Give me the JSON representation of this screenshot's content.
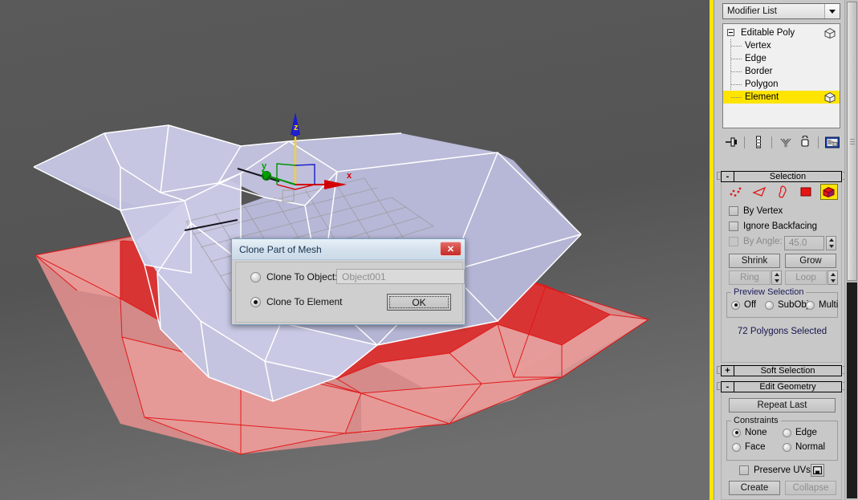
{
  "app": {
    "viewport_bg": "#545454",
    "active_viewport_border": "#ffe400",
    "panel_bg": "#c8c8c8"
  },
  "viewport": {
    "gizmo": {
      "x_label": "x",
      "y_label": "y",
      "z_label": "z",
      "x_color": "#e00000",
      "y_color": "#00a000",
      "z_color": "#ffd400"
    },
    "meshes": [
      {
        "name": "unselected-mesh",
        "fill": "#b6b6d6",
        "wire": "#ffffff"
      },
      {
        "name": "selected-mesh",
        "fill": "#d83030",
        "wire": "#e01010"
      }
    ]
  },
  "command_panel": {
    "modifier_list": {
      "label": "Modifier List",
      "icon": "chevron-down-icon"
    },
    "modifier_stack": [
      {
        "label": "Editable Poly",
        "level": 0,
        "selected": false,
        "icon": "cube-icon"
      },
      {
        "label": "Vertex",
        "level": 1,
        "selected": false
      },
      {
        "label": "Edge",
        "level": 1,
        "selected": false
      },
      {
        "label": "Border",
        "level": 1,
        "selected": false
      },
      {
        "label": "Polygon",
        "level": 1,
        "selected": false
      },
      {
        "label": "Element",
        "level": 1,
        "selected": true,
        "icon": "cube-icon"
      }
    ],
    "stack_tools": [
      {
        "name": "pin-stack-icon"
      },
      {
        "name": "show-end-result-icon"
      },
      {
        "name": "make-unique-icon"
      },
      {
        "name": "remove-modifier-icon"
      },
      {
        "name": "configure-modifier-sets-icon"
      }
    ],
    "selection_rollout": {
      "title": "Selection",
      "expander": "-",
      "subobject_icons": [
        {
          "name": "vertex-icon",
          "active": false
        },
        {
          "name": "edge-icon",
          "active": false
        },
        {
          "name": "border-icon",
          "active": false
        },
        {
          "name": "polygon-icon",
          "active": false
        },
        {
          "name": "element-icon",
          "active": true
        }
      ],
      "by_vertex": {
        "label": "By Vertex",
        "checked": false
      },
      "ignore_backfacing": {
        "label": "Ignore Backfacing",
        "checked": false
      },
      "by_angle": {
        "label": "By Angle:",
        "checked": false,
        "value": "45.0",
        "disabled": true
      },
      "shrink_label": "Shrink",
      "grow_label": "Grow",
      "ring_label": "Ring",
      "loop_label": "Loop",
      "preview_selection": {
        "title": "Preview Selection",
        "options": [
          {
            "label": "Off",
            "selected": true
          },
          {
            "label": "SubObj",
            "selected": false
          },
          {
            "label": "Multi",
            "selected": false
          }
        ]
      },
      "status": "72 Polygons Selected"
    },
    "soft_selection_rollout": {
      "title": "Soft Selection",
      "expander": "+"
    },
    "edit_geometry_rollout": {
      "title": "Edit Geometry",
      "expander": "-",
      "repeat_last_label": "Repeat Last",
      "constraints": {
        "title": "Constraints",
        "options": [
          {
            "label": "None",
            "selected": true
          },
          {
            "label": "Edge",
            "selected": false
          },
          {
            "label": "Face",
            "selected": false
          },
          {
            "label": "Normal",
            "selected": false
          }
        ]
      },
      "preserve_uvs": {
        "label": "Preserve UVs",
        "checked": false,
        "settings_icon": "uv-settings-icon"
      },
      "create_label": "Create",
      "collapse_label": "Collapse"
    }
  },
  "dialog": {
    "title": "Clone Part of Mesh",
    "close_icon": "close-icon",
    "close_glyph": "✕",
    "clone_to_object": {
      "label": "Clone To Object:",
      "selected": false
    },
    "object_name_value": "Object001",
    "clone_to_element": {
      "label": "Clone To Element",
      "selected": true
    },
    "ok_label": "OK"
  }
}
